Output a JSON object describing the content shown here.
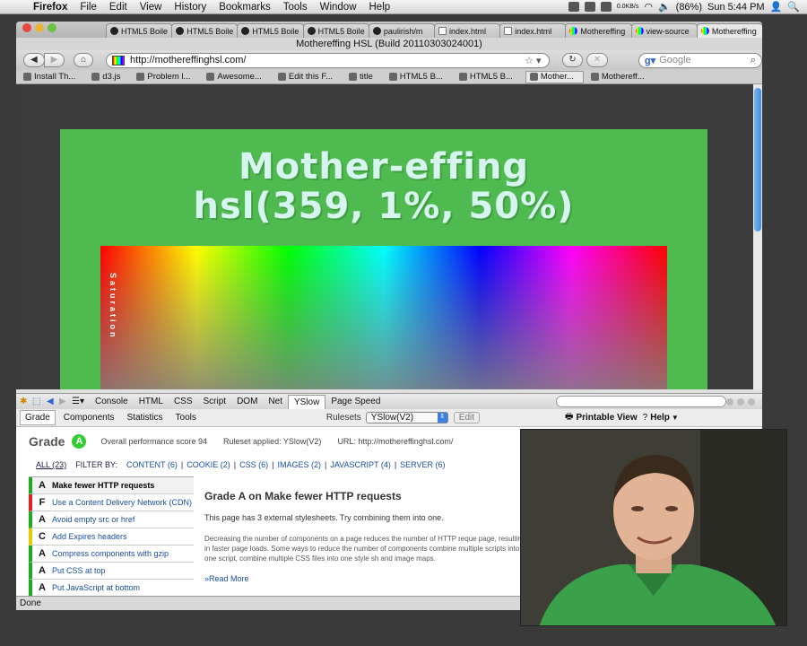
{
  "menubar": {
    "app": "Firefox",
    "items": [
      "File",
      "Edit",
      "View",
      "History",
      "Bookmarks",
      "Tools",
      "Window",
      "Help"
    ],
    "battery": "(86%)",
    "clock": "Sun 5:44 PM",
    "net": "0.0KB/s"
  },
  "window": {
    "title": "Mothereffing HSL (Build 20110303024001)"
  },
  "tabs": [
    {
      "label": "HTML5 Boile",
      "fav": "gh"
    },
    {
      "label": "HTML5 Boile",
      "fav": "gh"
    },
    {
      "label": "HTML5 Boile",
      "fav": "gh"
    },
    {
      "label": "HTML5 Boile",
      "fav": "gh"
    },
    {
      "label": "paulirish/m",
      "fav": "gh"
    },
    {
      "label": "index.html",
      "fav": "pg"
    },
    {
      "label": "index.html",
      "fav": "pg"
    },
    {
      "label": "Mothereffing",
      "fav": "rb"
    },
    {
      "label": "view-source",
      "fav": "rb"
    },
    {
      "label": "Mothereffing",
      "fav": "rb",
      "active": true
    }
  ],
  "nav": {
    "url": "http://mothereffinghsl.com/",
    "search_placeholder": "Google"
  },
  "bookmarks": [
    {
      "label": "Install Th..."
    },
    {
      "label": "d3.js"
    },
    {
      "label": "Problem l..."
    },
    {
      "label": "Awesome..."
    },
    {
      "label": "Edit this F..."
    },
    {
      "label": "title"
    },
    {
      "label": "HTML5 B..."
    },
    {
      "label": "HTML5 B..."
    },
    {
      "label": "Mother...",
      "active": true
    },
    {
      "label": "Mothereff..."
    }
  ],
  "page": {
    "heading_line1": "Mother-effing",
    "heading_line2": "hsl(359, 1%, 50%)",
    "saturation_label": "Saturation"
  },
  "firebug": {
    "tabs": [
      "Console",
      "HTML",
      "CSS",
      "Script",
      "DOM",
      "Net",
      "YSlow",
      "Page Speed"
    ],
    "active_tab": "YSlow"
  },
  "yslow": {
    "tabs": [
      "Grade",
      "Components",
      "Statistics",
      "Tools"
    ],
    "rulesets_label": "Rulesets",
    "ruleset_value": "YSlow(V2)",
    "edit_label": "Edit",
    "printable": "Printable View",
    "help": "Help",
    "grade_label": "Grade",
    "grade": "A",
    "score": "Overall performance score 94",
    "ruleset_applied": "Ruleset applied: YSlow(V2)",
    "url_line": "URL: http://mothereffinghsl.com/",
    "filter_label": "FILTER BY:",
    "filters": [
      "ALL (23)",
      "CONTENT (6)",
      "COOKIE (2)",
      "CSS (6)",
      "IMAGES (2)",
      "JAVASCRIPT (4)",
      "SERVER (6)"
    ],
    "rules": [
      {
        "grade": "A",
        "label": "Make fewer HTTP requests",
        "color": "#22aa22",
        "selected": true
      },
      {
        "grade": "F",
        "label": "Use a Content Delivery Network (CDN)",
        "color": "#dd2222"
      },
      {
        "grade": "A",
        "label": "Avoid empty src or href",
        "color": "#22aa22"
      },
      {
        "grade": "C",
        "label": "Add Expires headers",
        "color": "#e8c800"
      },
      {
        "grade": "A",
        "label": "Compress components with gzip",
        "color": "#22aa22"
      },
      {
        "grade": "A",
        "label": "Put CSS at top",
        "color": "#22aa22"
      },
      {
        "grade": "A",
        "label": "Put JavaScript at bottom",
        "color": "#22aa22"
      }
    ],
    "detail_title": "Grade A on Make fewer HTTP requests",
    "detail_summary": "This page has 3 external stylesheets. Try combining them into one.",
    "detail_body": "Decreasing the number of components on a page reduces the number of HTTP reque page, resulting in faster page loads. Some ways to reduce the number of components combine multiple scripts into one script, combine multiple CSS files into one style sh and image maps.",
    "read_more": "»Read More"
  },
  "status": "Done"
}
